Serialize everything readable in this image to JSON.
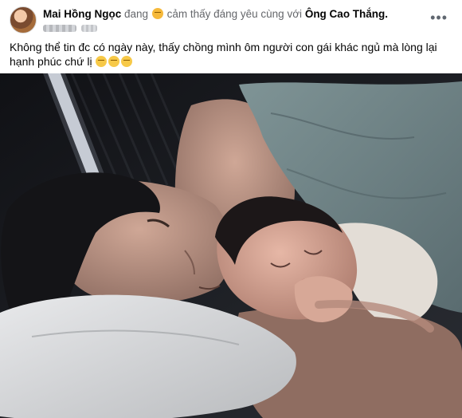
{
  "post": {
    "author_name": "Mai Hồng Ngọc",
    "feeling_prefix": "đang",
    "feeling_text": "cảm thấy đáng yêu cùng với",
    "tagged_name": "Ông Cao Thắng.",
    "feeling_icon": "smiling-face-icon",
    "more_icon": "more-options-icon",
    "more_label": "•••",
    "body_text": "Không thể tin đc có ngày này, thấy chồng mình ôm người con gái khác ngủ mà lòng lại hạnh phúc chứ lị",
    "emojis": [
      "persevering-face-icon",
      "persevering-face-icon",
      "persevering-face-icon"
    ],
    "photo_subject": "photo"
  },
  "colors": {
    "name": "#050505",
    "secondary_text": "#65676b",
    "background": "#ffffff"
  }
}
